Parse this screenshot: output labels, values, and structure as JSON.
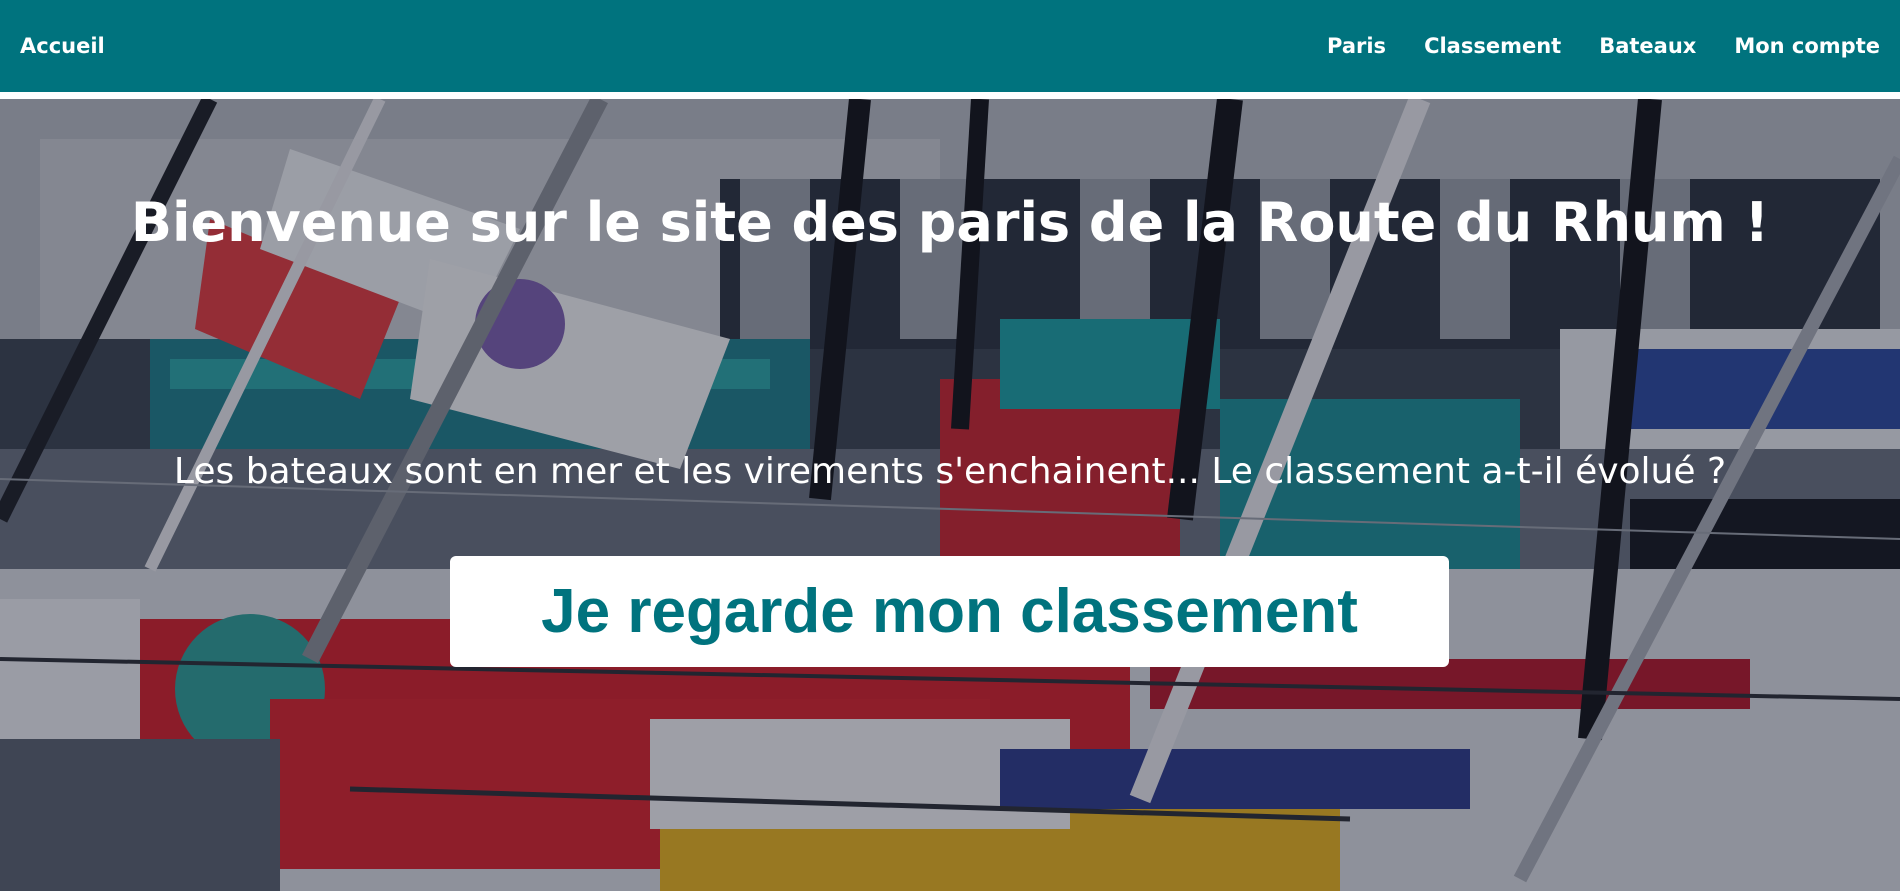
{
  "nav": {
    "home_label": "Accueil",
    "items": [
      "Paris",
      "Classement",
      "Bateaux",
      "Mon compte"
    ]
  },
  "hero": {
    "title": "Bienvenue sur le site des paris de la Route du Rhum !",
    "subtitle": "Les bateaux sont en mer et les virements s'enchainent... Le classement a-t-il évolué ?",
    "cta_label": "Je regarde mon classement"
  },
  "colors": {
    "primary": "#00737e",
    "text_light": "#ffffff"
  }
}
